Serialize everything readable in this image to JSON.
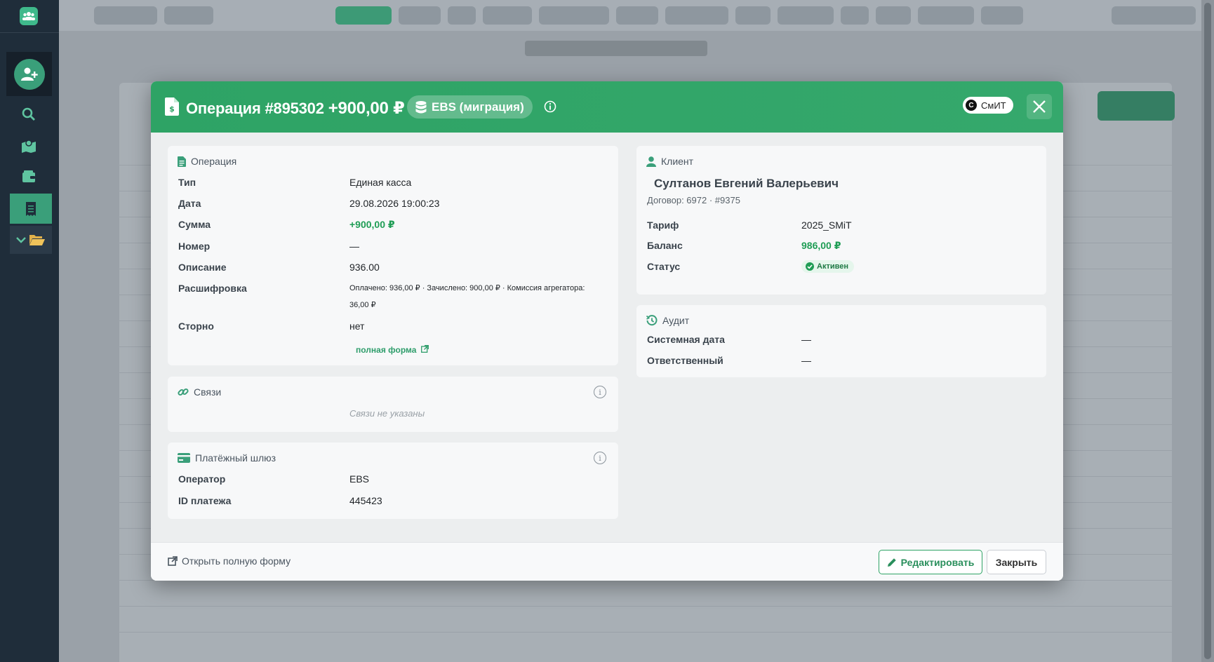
{
  "modal": {
    "title": "Операция #895302",
    "amount": "+900,00 ₽",
    "source_badge": "EBS (миграция)",
    "brand": "СмИТ",
    "brand_letter": "С"
  },
  "operation": {
    "header": "Операция",
    "fields": [
      {
        "label": "Тип",
        "value": "Единая касса"
      },
      {
        "label": "Дата",
        "value": "29.08.2026 19:00:23"
      },
      {
        "label": "Сумма",
        "value": "+900,00 ₽"
      },
      {
        "label": "Номер",
        "value": "—"
      },
      {
        "label": "Описание",
        "value": "936.00"
      },
      {
        "label": "Расшифровка",
        "value": "Оплачено: 936,00 ₽ · Зачислено: 900,00 ₽ · Комиссия агрегатора: 36,00 ₽"
      },
      {
        "label": "Сторно",
        "value": "нет"
      }
    ],
    "full_form_link": "полная форма"
  },
  "links": {
    "header": "Связи",
    "empty": "Связи не указаны"
  },
  "gateway": {
    "header": "Платёжный шлюз",
    "fields": [
      {
        "label": "Оператор",
        "value": "EBS"
      },
      {
        "label": "ID платежа",
        "value": "445423"
      }
    ]
  },
  "client": {
    "header": "Клиент",
    "name": "Султанов Евгений Валерьевич",
    "contract": "Договор: 6972 · #9375",
    "fields": [
      {
        "label": "Тариф",
        "value": "2025_SMiT"
      },
      {
        "label": "Баланс",
        "value": "986,00 ₽"
      },
      {
        "label": "Статус",
        "value": "Активен"
      }
    ]
  },
  "audit": {
    "header": "Аудит",
    "fields": [
      {
        "label": "Системная дата",
        "value": "—"
      },
      {
        "label": "Ответственный",
        "value": "—"
      }
    ]
  },
  "footer": {
    "open_full": "Открыть полную форму",
    "edit": "Редактировать",
    "close": "Закрыть"
  },
  "colors": {
    "header_green": "#2ea365",
    "sidebar": "#1f2d3a",
    "accent": "#3a9f7a",
    "positive": "#1f9d55"
  }
}
